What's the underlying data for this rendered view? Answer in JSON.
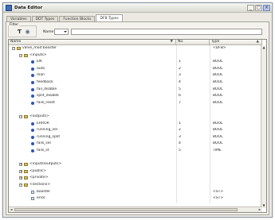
{
  "window": {
    "title": "Data Editor",
    "buttons": [
      "_",
      "□",
      "×"
    ]
  },
  "tabs": [
    "Variables",
    "DDT Types",
    "Function Blocks",
    "DFB Types"
  ],
  "toolbar": {
    "filter_label": "Filter",
    "status_label": "Name",
    "status_value": "",
    "filter_value": ""
  },
  "columns": [
    {
      "label": "Name",
      "sort_icon": "▼"
    },
    {
      "label": "No.",
      "sort_icon": ""
    },
    {
      "label": "Type",
      "sort_icon": "▲"
    }
  ],
  "rows": [
    {
      "depth": 0,
      "expander": "−",
      "icon": "folder",
      "name": "valve_mod:booster",
      "no": "",
      "type": "<DFB>"
    },
    {
      "depth": 1,
      "expander": "−",
      "icon": "folder",
      "name": "<inputs>",
      "no": "",
      "type": ""
    },
    {
      "depth": 2,
      "expander": "",
      "icon": "var",
      "name": "EN",
      "no": "1",
      "type": "BOOL"
    },
    {
      "depth": 2,
      "expander": "",
      "icon": "var",
      "name": "auto",
      "no": "2",
      "type": "BOOL"
    },
    {
      "depth": 2,
      "expander": "",
      "icon": "var",
      "name": "man",
      "no": "3",
      "type": "BOOL"
    },
    {
      "depth": 2,
      "expander": "",
      "icon": "var",
      "name": "feedback",
      "no": "4",
      "type": "BOOL"
    },
    {
      "depth": 2,
      "expander": "",
      "icon": "var",
      "name": "fail_disable",
      "no": "5",
      "type": "BOOL"
    },
    {
      "depth": 2,
      "expander": "",
      "icon": "var",
      "name": "split_disable",
      "no": "6",
      "type": "BOOL"
    },
    {
      "depth": 2,
      "expander": "",
      "icon": "var",
      "name": "fails_reset",
      "no": "7",
      "type": "BOOL"
    },
    {
      "depth": 2,
      "expander": "",
      "icon": "none",
      "name": "",
      "no": "",
      "type": ""
    },
    {
      "depth": 1,
      "expander": "−",
      "icon": "folder",
      "name": "<outputs>",
      "no": "",
      "type": ""
    },
    {
      "depth": 2,
      "expander": "",
      "icon": "var",
      "name": "ERROR",
      "no": "1",
      "type": "BOOL"
    },
    {
      "depth": 2,
      "expander": "",
      "icon": "var",
      "name": "running_sel",
      "no": "2",
      "type": "BOOL"
    },
    {
      "depth": 2,
      "expander": "",
      "icon": "var",
      "name": "running_split",
      "no": "3",
      "type": "BOOL"
    },
    {
      "depth": 2,
      "expander": "",
      "icon": "var",
      "name": "fails_sel",
      "no": "4",
      "type": "BOOL"
    },
    {
      "depth": 2,
      "expander": "",
      "icon": "var",
      "name": "fails_st",
      "no": "5",
      "type": "TIME"
    },
    {
      "depth": 2,
      "expander": "",
      "icon": "none",
      "name": "",
      "no": "",
      "type": ""
    },
    {
      "depth": 1,
      "expander": "+",
      "icon": "folder",
      "name": "<inputs/outputs>",
      "no": "",
      "type": ""
    },
    {
      "depth": 1,
      "expander": "+",
      "icon": "folder",
      "name": "<public>",
      "no": "",
      "type": ""
    },
    {
      "depth": 1,
      "expander": "+",
      "icon": "folder",
      "name": "<private>",
      "no": "",
      "type": ""
    },
    {
      "depth": 1,
      "expander": "−",
      "icon": "folder",
      "name": "<sections>",
      "no": "",
      "type": ""
    },
    {
      "depth": 2,
      "expander": "",
      "icon": "doc",
      "name": "booster",
      "no": "",
      "type": "<ST>"
    },
    {
      "depth": 2,
      "expander": "",
      "icon": "doc",
      "name": "error",
      "no": "",
      "type": "<ST>"
    }
  ],
  "scrollbars": {
    "up": "▲",
    "down": "▼",
    "left": "◄",
    "right": "►"
  }
}
